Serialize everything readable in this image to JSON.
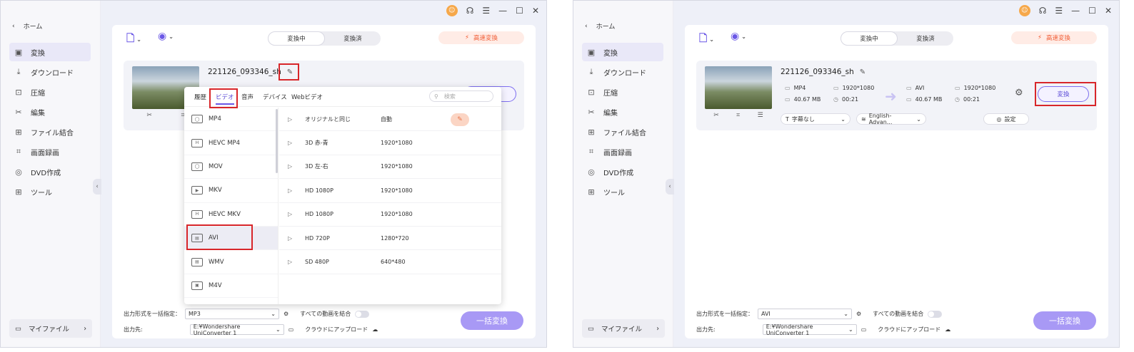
{
  "common": {
    "sidebar": {
      "home": "ホーム",
      "items": [
        {
          "label": "変換",
          "icon": "convert-icon"
        },
        {
          "label": "ダウンロード",
          "icon": "download-icon"
        },
        {
          "label": "圧縮",
          "icon": "compress-icon"
        },
        {
          "label": "編集",
          "icon": "scissors-icon"
        },
        {
          "label": "ファイル結合",
          "icon": "merge-icon"
        },
        {
          "label": "画面録画",
          "icon": "record-icon"
        },
        {
          "label": "DVD作成",
          "icon": "dvd-icon"
        },
        {
          "label": "ツール",
          "icon": "tools-icon"
        }
      ],
      "footer": "マイファイル"
    },
    "tabs": {
      "converting": "変換中",
      "converted": "変換済"
    },
    "fast_convert": "高速変換",
    "file": {
      "name": "221126_093346_sh",
      "src_format": "MP4",
      "src_resolution": "1920*1080",
      "src_size": "40.67 MB",
      "src_duration": "00:21",
      "dst_format": "AVI",
      "dst_resolution": "1920*1080",
      "dst_size": "40.67 MB",
      "dst_duration": "00:21",
      "subtitle": "字幕なし",
      "audio": "English-Advan...",
      "settings": "設定",
      "convert": "変換"
    },
    "bottom": {
      "format_label": "出力形式を一括指定：",
      "dest_label": "出力先:",
      "dest_path": "E:¥Wondershare UniConverter 1",
      "merge_all": "すべての動画を結合",
      "upload_cloud": "クラウドにアップロード",
      "batch_convert": "一括変換"
    }
  },
  "left": {
    "output_format": "MP3",
    "popup": {
      "tabs": [
        "履歴",
        "ビデオ",
        "音声",
        "デバイス",
        "Webビデオ"
      ],
      "search_placeholder": "検索",
      "formats": [
        "MP4",
        "HEVC MP4",
        "MOV",
        "MKV",
        "HEVC MKV",
        "AVI",
        "WMV",
        "M4V"
      ],
      "presets": [
        {
          "name": "オリジナルと同じ",
          "res": "自動"
        },
        {
          "name": "3D 赤-青",
          "res": "1920*1080"
        },
        {
          "name": "3D 左-右",
          "res": "1920*1080"
        },
        {
          "name": "HD 1080P",
          "res": "1920*1080"
        },
        {
          "name": "HD 1080P",
          "res": "1920*1080"
        },
        {
          "name": "HD 720P",
          "res": "1280*720"
        },
        {
          "name": "SD 480P",
          "res": "640*480"
        }
      ]
    }
  },
  "right": {
    "output_format": "AVI"
  },
  "colors": {
    "accent": "#6a57e6",
    "highlight": "#d8262a",
    "fast": "#f05a32"
  }
}
